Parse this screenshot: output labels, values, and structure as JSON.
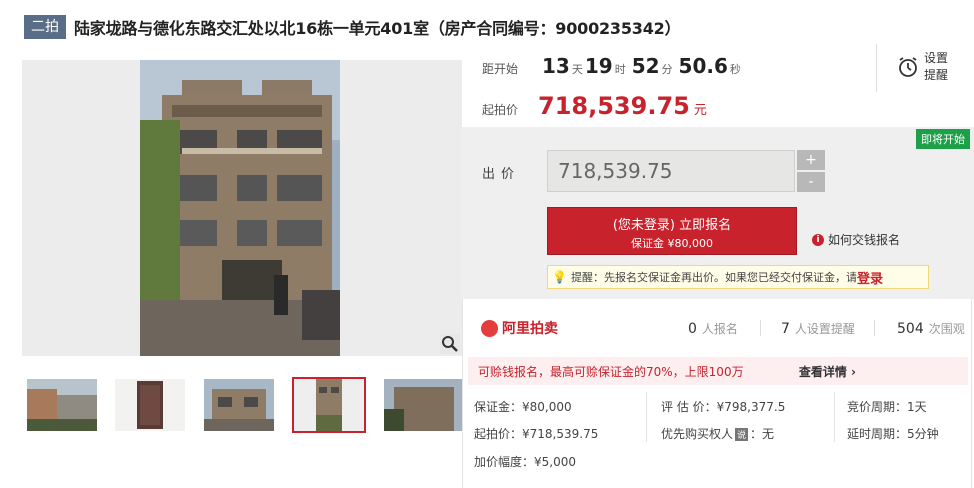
{
  "header": {
    "round_badge": "二拍",
    "title": "陆家垅路与德化东路交汇处以北16栋一单元401室（房产合同编号：9000235342）"
  },
  "countdown": {
    "label": "距开始",
    "days": "13",
    "days_unit": "天",
    "hours": "19",
    "hours_unit": "时",
    "minutes": "52",
    "minutes_unit": "分",
    "seconds": "50.6",
    "seconds_unit": "秒"
  },
  "reminder": {
    "line1": "设置",
    "line2": "提醒"
  },
  "start_price": {
    "label": "起拍价",
    "value": "718,539.75",
    "unit": "元"
  },
  "bid_panel": {
    "status_badge": "即将开始",
    "bid_label": "出价",
    "bid_value": "718,539.75",
    "plus": "+",
    "minus": "-",
    "register_line1": "(您未登录) 立即报名",
    "register_line2": "保证金 ¥80,000",
    "how_pay": "如何交钱报名",
    "tip_text": "提醒：先报名交保证金再出价。如果您已经交付保证金，请",
    "tip_login": "登录"
  },
  "stats": {
    "brand": "阿里拍卖",
    "enrolled_count": "0",
    "enrolled_label": "人报名",
    "reminders_count": "7",
    "reminders_label": "人设置提醒",
    "views_count": "504",
    "views_label": "次围观"
  },
  "promo": {
    "text": "可赊钱报名，最高可赊保证金的70%，上限100万",
    "link": "查看详情 ›"
  },
  "details": {
    "deposit": "保证金：¥80,000",
    "appraisal": "评 估 价：¥798,377.5",
    "period": "竞价周期：1天",
    "start_price": "起拍价：¥718,539.75",
    "priority_prefix": "优先购买权人",
    "priority_tag": "说",
    "priority_value": "：无",
    "extension": "延时周期：5分钟",
    "increment": "加价幅度：¥5,000"
  },
  "colors": {
    "accent_red": "#c8232c",
    "badge_slate": "#5a6d86",
    "status_green": "#1ea04a"
  },
  "icons": {
    "alarm": "alarm-clock-icon",
    "zoom": "magnifier-icon",
    "info": "info-circle-icon",
    "tip": "lightbulb-icon"
  }
}
